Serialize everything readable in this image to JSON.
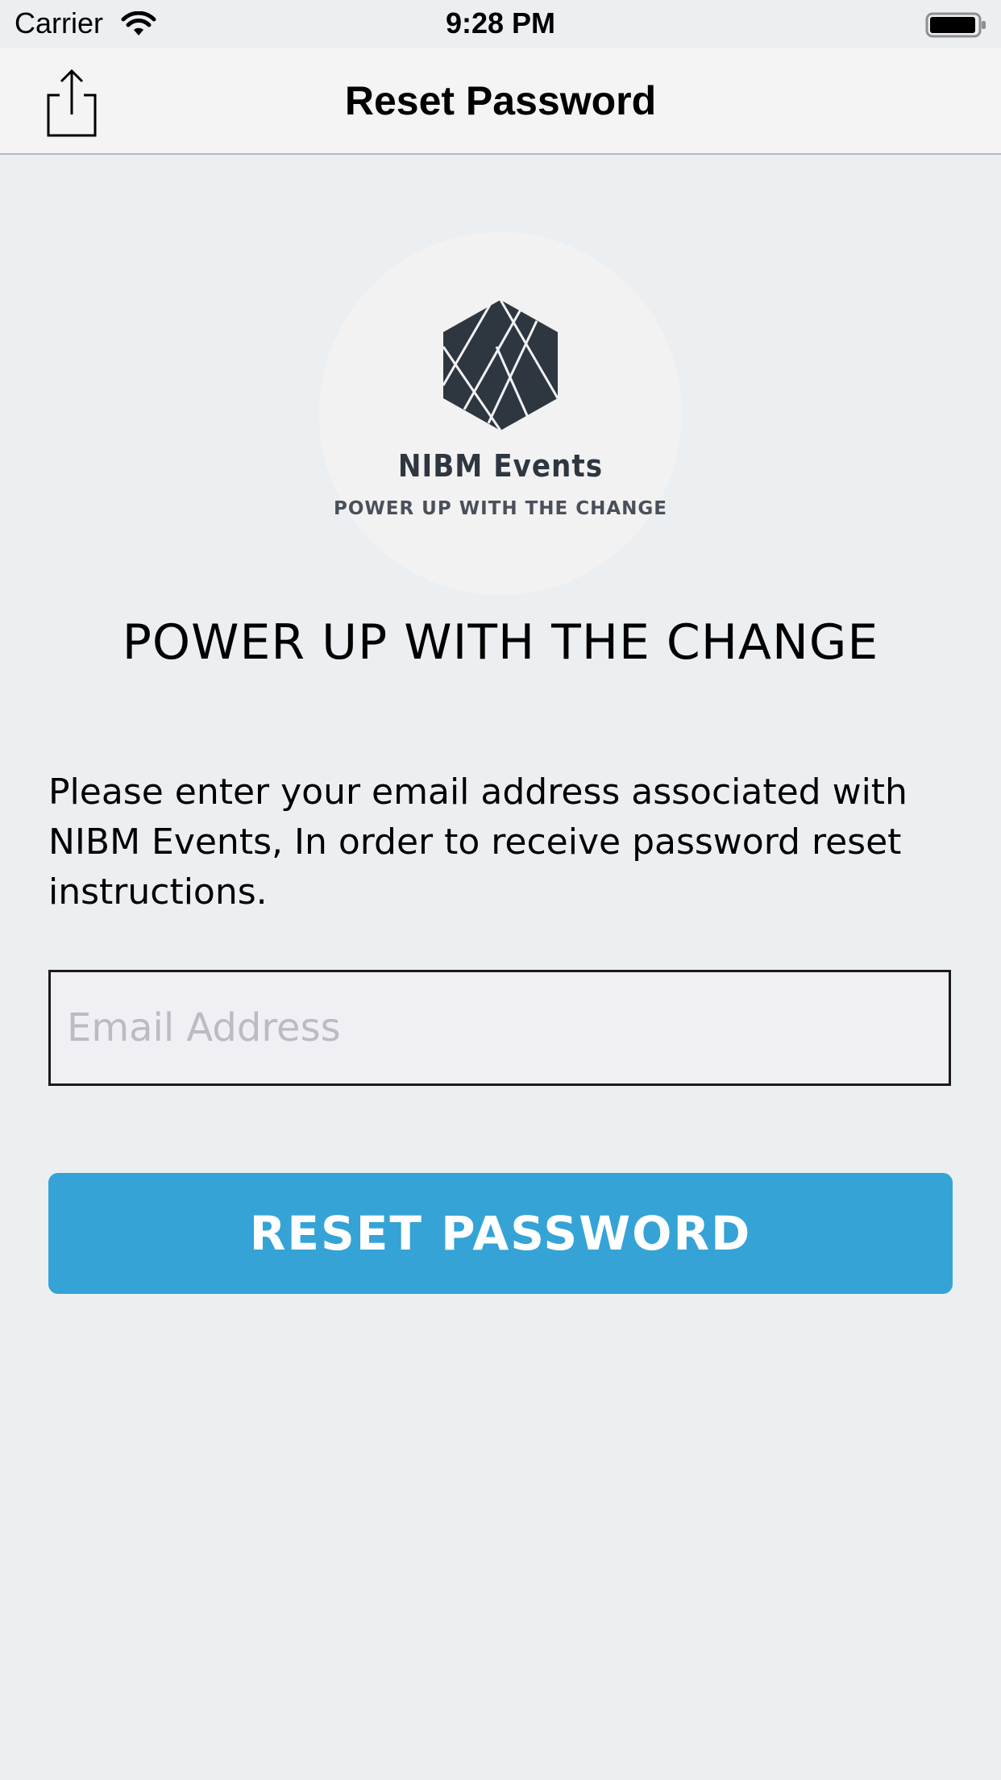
{
  "status_bar": {
    "carrier": "Carrier",
    "time": "9:28 PM",
    "wifi_icon": "wifi-icon",
    "battery_icon": "battery-icon"
  },
  "nav": {
    "title": "Reset Password",
    "share_icon": "share-icon"
  },
  "logo": {
    "name": "NIBM Events",
    "tagline": "POWER UP WITH THE CHANGE",
    "icon": "hexagon-logo-icon"
  },
  "headline": "POWER UP WITH THE CHANGE",
  "instructions": "Please enter your email address associated with NIBM Events, In order to receive password reset instructions.",
  "email": {
    "placeholder": "Email Address",
    "value": ""
  },
  "reset_button": {
    "label": "RESET PASSWORD"
  },
  "colors": {
    "background": "#ECEFF1",
    "accent": "#35A3D6",
    "logo_dark": "#2E3640"
  }
}
